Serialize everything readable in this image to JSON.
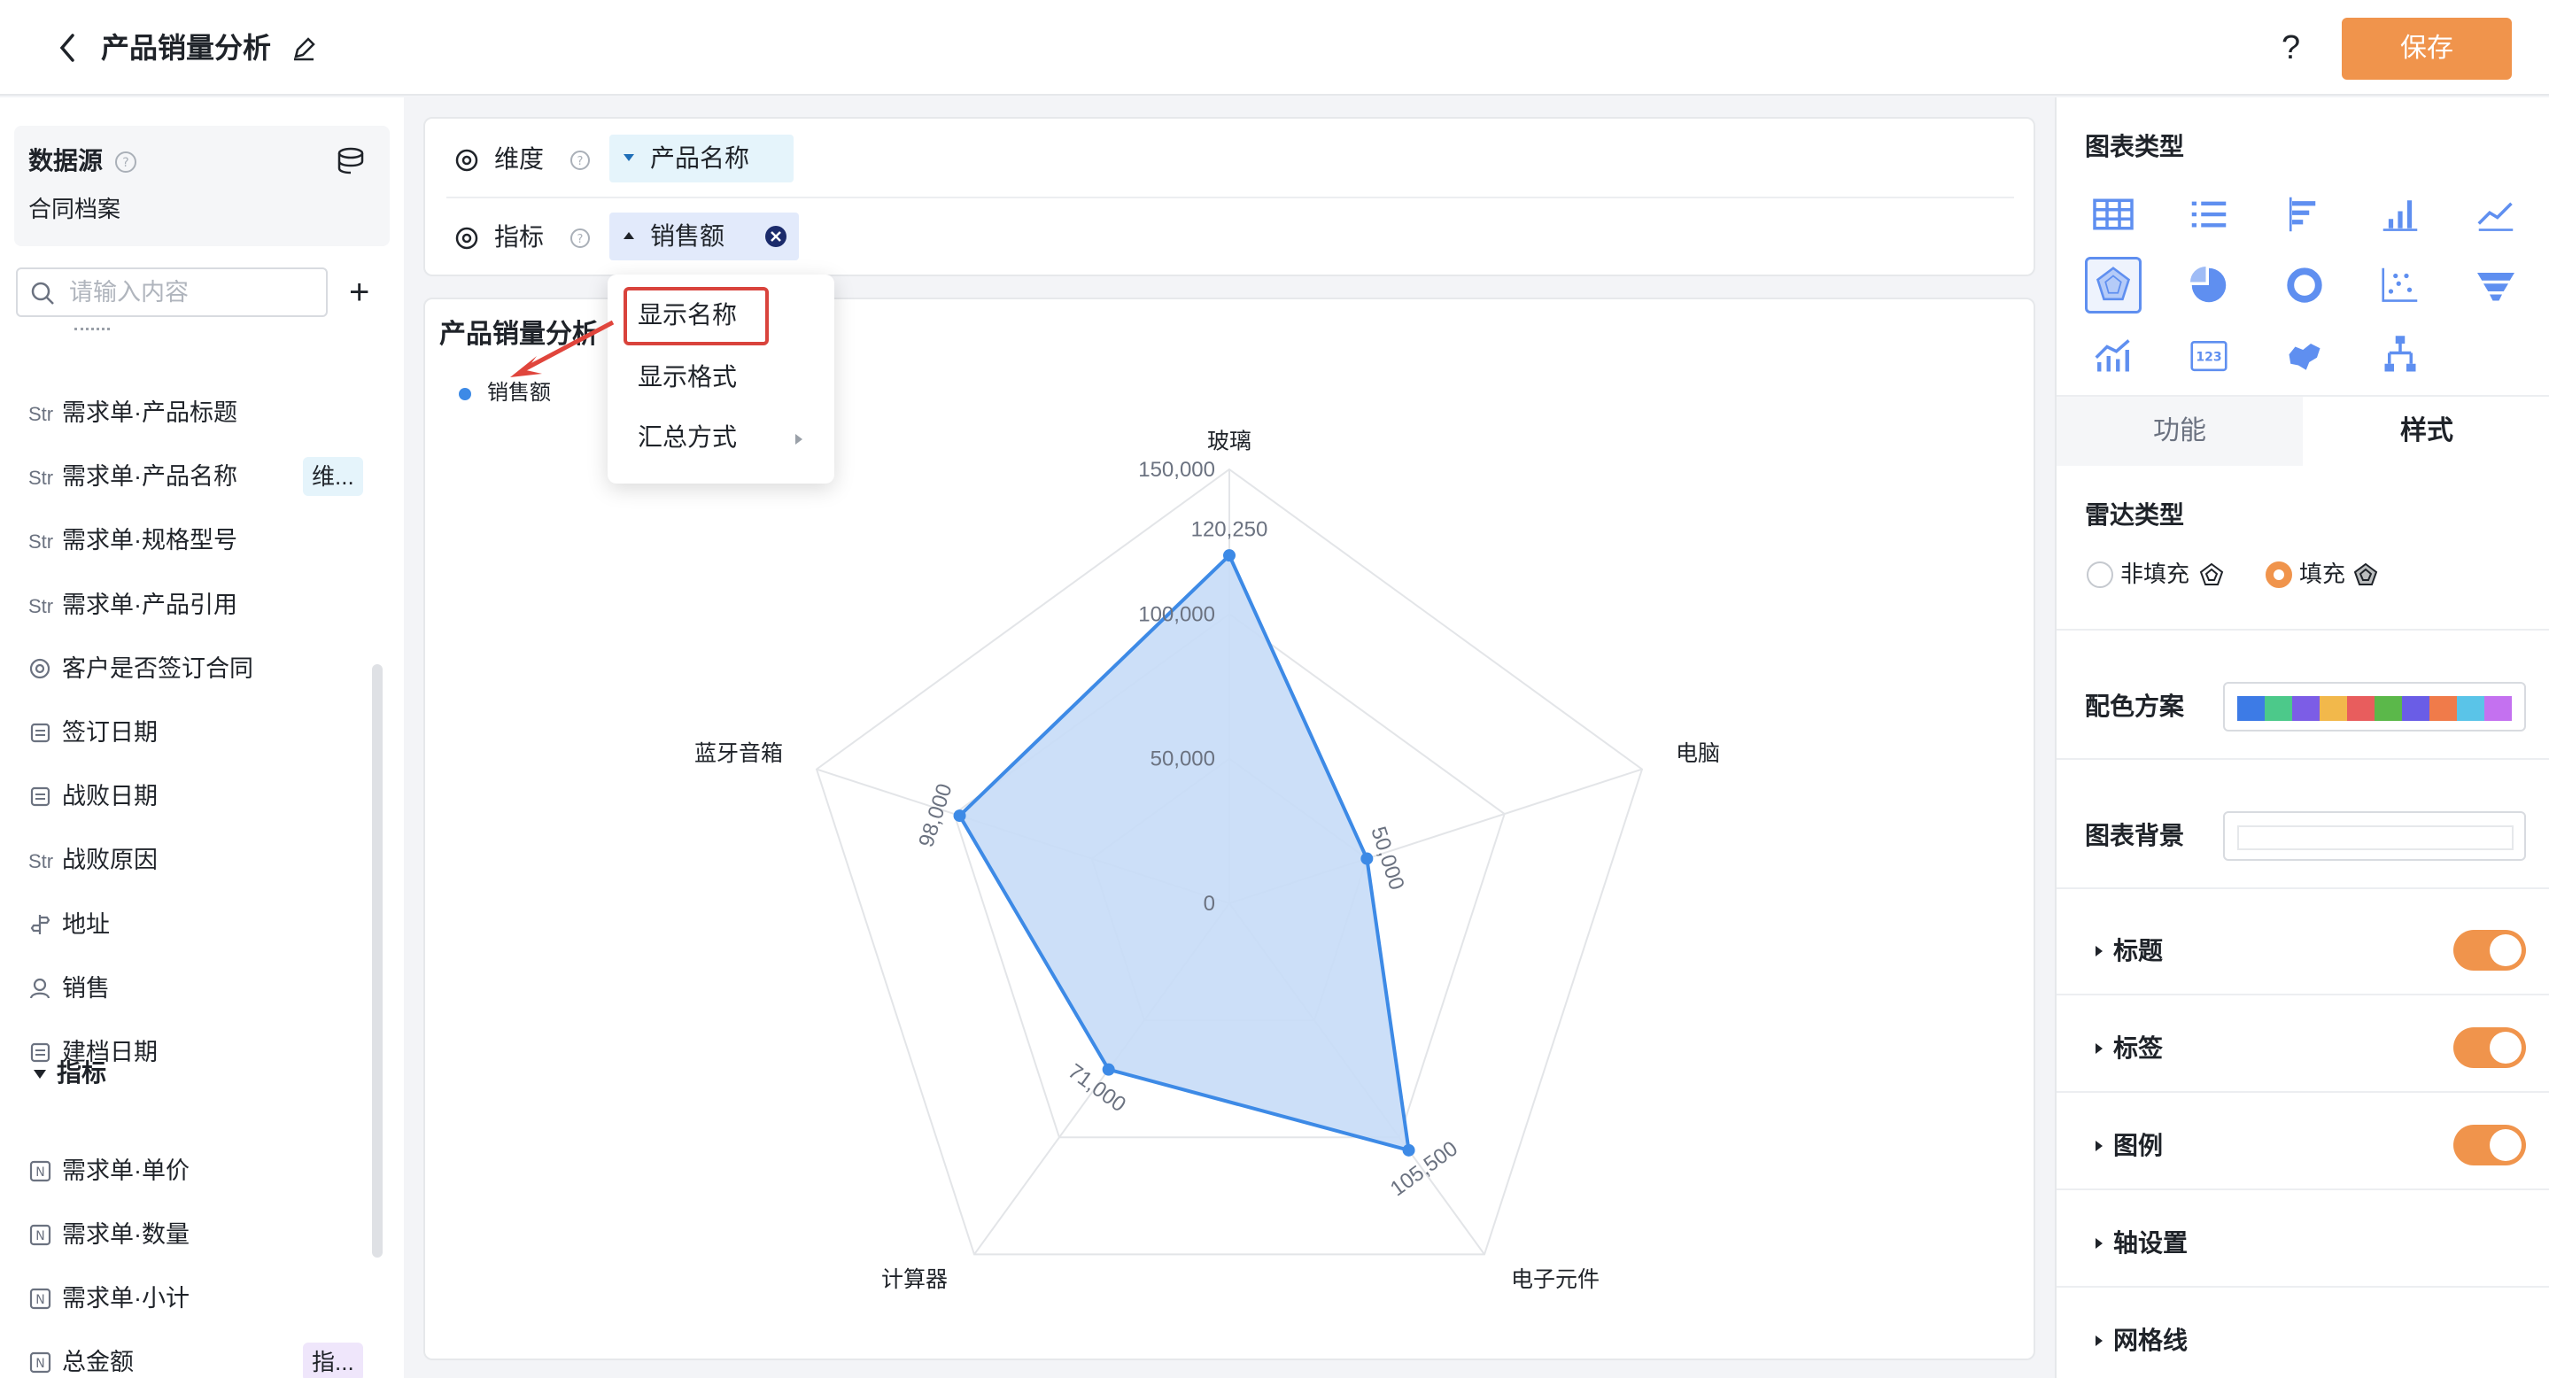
{
  "header": {
    "title": "产品销量分析",
    "help": "?",
    "save_label": "保存"
  },
  "sidebar": {
    "datasource_title": "数据源",
    "datasource_name": "合同档案",
    "search_placeholder": "请输入内容",
    "add": "+",
    "fields": [
      {
        "type": "Str",
        "label": "需求单·产品标题"
      },
      {
        "type": "Str",
        "label": "需求单·产品名称",
        "tag": "维..."
      },
      {
        "type": "Str",
        "label": "需求单·规格型号"
      },
      {
        "type": "Str",
        "label": "需求单·产品引用"
      },
      {
        "type": "radio",
        "label": "客户是否签订合同"
      },
      {
        "type": "date",
        "label": "签订日期"
      },
      {
        "type": "date",
        "label": "战败日期"
      },
      {
        "type": "Str",
        "label": "战败原因"
      },
      {
        "type": "geo",
        "label": "地址"
      },
      {
        "type": "user",
        "label": "销售"
      },
      {
        "type": "date",
        "label": "建档日期"
      }
    ],
    "metrics_group": "指标",
    "metrics": [
      {
        "type": "N",
        "label": "需求单·单价"
      },
      {
        "type": "N",
        "label": "需求单·数量"
      },
      {
        "type": "N",
        "label": "需求单·小计"
      },
      {
        "type": "N",
        "label": "总金额",
        "tag": "指..."
      }
    ]
  },
  "config": {
    "dimension_label": "维度",
    "dimension_value": "产品名称",
    "metric_label": "指标",
    "metric_value": "销售额"
  },
  "dropdown": {
    "items": [
      "显示名称",
      "显示格式",
      "汇总方式"
    ]
  },
  "chart_data": {
    "type": "radar",
    "title": "产品销量分析",
    "legend": {
      "entries": [
        "销售额"
      ],
      "placement": "top-left"
    },
    "axes": [
      "玻璃",
      "电脑",
      "电子元件",
      "计算器",
      "蓝牙音箱"
    ],
    "range": [
      0,
      150000
    ],
    "ticks": [
      "0",
      "50,000",
      "100,000",
      "150,000"
    ],
    "tick_values": [
      0,
      50000,
      100000,
      150000
    ],
    "series": [
      {
        "name": "销售额",
        "values": [
          120250,
          50000,
          105500,
          71000,
          98000
        ],
        "labels": [
          "120,250",
          "50,000",
          "105,500",
          "71,000",
          "98,000"
        ]
      }
    ],
    "colors": {
      "line": "#3d8ae6",
      "fill": "#c7dcf7",
      "grid": "#e3e5e8"
    }
  },
  "right_panel": {
    "chart_type_title": "图表类型",
    "tabs": [
      "功能",
      "样式"
    ],
    "radar_type_title": "雷达类型",
    "radar_options": [
      "非填充",
      "填充"
    ],
    "color_scheme_title": "配色方案",
    "color_scheme": [
      "#3d7be6",
      "#4cc98a",
      "#7c5de6",
      "#f2b84b",
      "#e85d5d",
      "#5bb84a",
      "#6a5de6",
      "#f07b4a",
      "#5ac4e8",
      "#c471f0"
    ],
    "chart_bg_title": "图表背景",
    "sections": [
      "标题",
      "标签",
      "图例",
      "轴设置",
      "网格线"
    ]
  }
}
